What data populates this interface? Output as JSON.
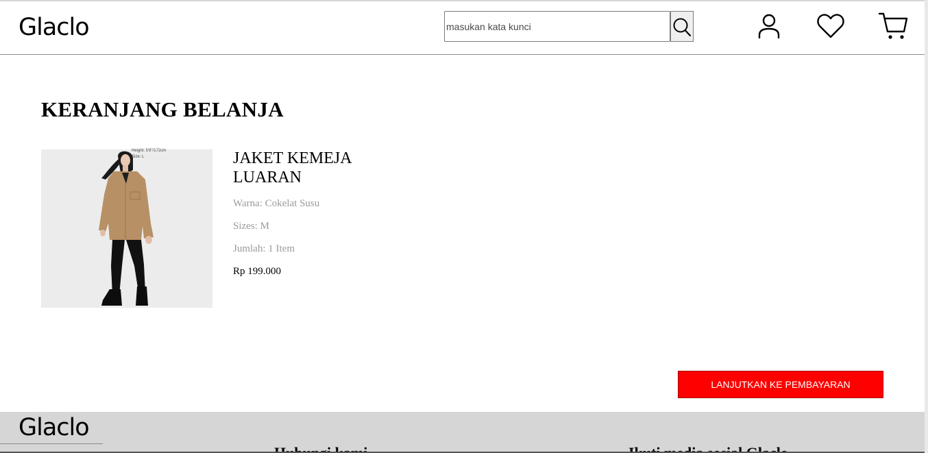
{
  "header": {
    "logo": "Glaclo",
    "search": {
      "placeholder": "masukan kata kunci",
      "value": ""
    },
    "icons": [
      "search-icon",
      "user-icon",
      "heart-icon",
      "cart-icon"
    ]
  },
  "cart": {
    "title": "KERANJANG BELANJA",
    "item": {
      "image_caption_line1": "Height: 5'8\"/172cm",
      "image_caption_line2": "Size: L",
      "name": "JAKET KEMEJA LUARAN",
      "color": "Warna: Cokelat Susu",
      "size": "Sizes: M",
      "quantity": "Jumlah: 1 Item",
      "price": "Rp 199.000"
    },
    "checkout_label": "LANJUTKAN KE PEMBAYARAN"
  },
  "footer": {
    "logo": "Glaclo",
    "heading_1": "Hubungi kami",
    "heading_2": "Ikuti media sosial Glaclo"
  },
  "colors": {
    "accent": "#ff0000",
    "footer_bg": "#d6d6d6",
    "muted_text": "#9a9a9a"
  }
}
